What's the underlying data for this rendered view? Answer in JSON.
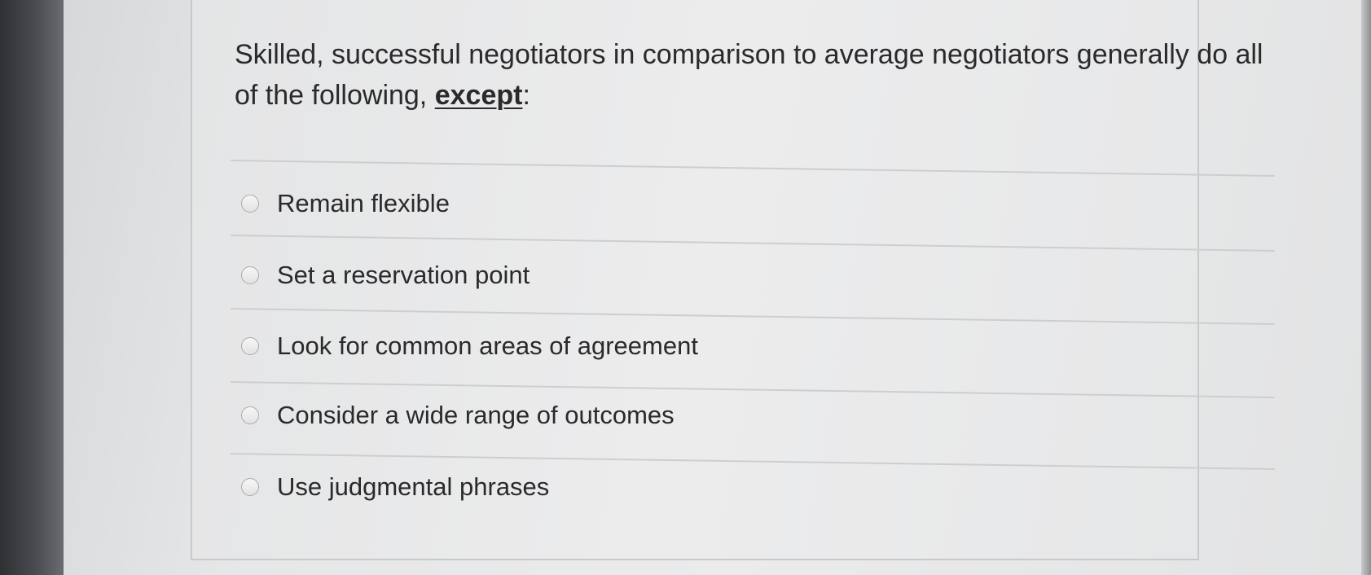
{
  "question": {
    "text": "Skilled, successful negotiators in comparison to average negotiators generally do all of the following,",
    "emphasis": "except",
    "trailing": ":"
  },
  "answers": [
    {
      "label": "Remain flexible",
      "selected": false
    },
    {
      "label": "Set a reservation point",
      "selected": false
    },
    {
      "label": "Look for common areas of agreement",
      "selected": false
    },
    {
      "label": "Consider a wide range of outcomes",
      "selected": false
    },
    {
      "label": "Use judgmental phrases",
      "selected": false
    }
  ]
}
